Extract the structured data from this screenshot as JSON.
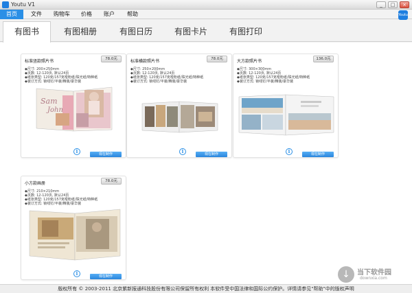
{
  "window": {
    "title": "Youtu V1"
  },
  "window_buttons": {
    "minimize": "_",
    "maximize": "□",
    "close": "×"
  },
  "menu": [
    {
      "label": "首页",
      "active": true
    },
    {
      "label": "文件"
    },
    {
      "label": "购物车"
    },
    {
      "label": "价格"
    },
    {
      "label": "账户"
    },
    {
      "label": "帮助"
    }
  ],
  "brand_badge": "Youtu",
  "tabs": [
    {
      "label": "有图书",
      "active": true
    },
    {
      "label": "有图相册"
    },
    {
      "label": "有图日历"
    },
    {
      "label": "有图卡片"
    },
    {
      "label": "有图打印"
    }
  ],
  "products": [
    {
      "name": "标准竖款照片书",
      "price": "78.0元",
      "specs": [
        "◆尺寸: 200×250mm",
        "◆页数: 12-120页, 默认24页",
        "◆纸张类型: 120克/157克哑粉纸/珠光纸/特种纸",
        "◆装订方式: 锁线钉/平装/精装/豪华装"
      ],
      "button": "现在制作"
    },
    {
      "name": "标准横款照片书",
      "price": "78.0元",
      "specs": [
        "◆尺寸: 250×200mm",
        "◆页数: 12-120页, 默认24页",
        "◆纸张类型: 120克/157克哑粉纸/珠光纸/特种纸",
        "◆装订方式: 锁线钉/平装/精装/豪华装"
      ],
      "button": "现在制作"
    },
    {
      "name": "大方款照片书",
      "price": "136.0元",
      "specs": [
        "◆尺寸: 300×300mm",
        "◆页数: 12-120页, 默认24页",
        "◆纸张类型: 120克/157克哑粉纸/珠光纸/特种纸",
        "◆装订方式: 锁线钉/平装/精装/豪华装"
      ],
      "button": "现在制作"
    },
    {
      "name": "小方款画册",
      "price": "78.0元",
      "specs": [
        "◆尺寸: 210×210mm",
        "◆页数: 12-120页, 默认24页",
        "◆纸张类型: 120克/157克哑粉纸/珠光纸/特种纸",
        "◆装订方式: 锁线钉/平装/精装/豪华装"
      ],
      "button": "现在制作"
    }
  ],
  "photo_text": {
    "sam": "Sam",
    "john": "John"
  },
  "footer": "版权所有 © 2003-2011 北京紫新报通科技股份有限公司保留所有权利 本软件受中国法律和国际公约保护。详情请参见\"帮助\"中的版权声明",
  "watermark": {
    "title": "当下软件园",
    "sub": "downxia.com"
  }
}
